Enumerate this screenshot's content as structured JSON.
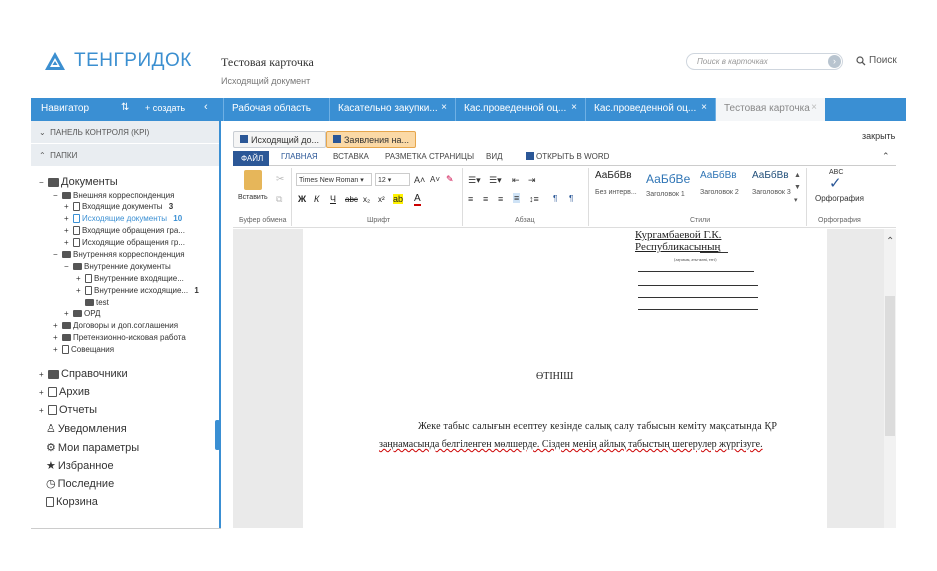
{
  "header": {
    "logo_text": "ТЕНГРИДОК",
    "card_title": "Тестовая карточка",
    "card_subtitle": "Исходящий документ",
    "search_placeholder": "Поиск в карточках",
    "search_label": "Поиск"
  },
  "navigator": {
    "title": "Навигатор",
    "sort_glyph": "⇅",
    "create_label": "+  создать",
    "collapse_glyph": "‹"
  },
  "tabs": [
    {
      "label": "Рабочая область",
      "closable": false
    },
    {
      "label": "Касательно закупки...",
      "closable": true
    },
    {
      "label": "Кас.проведенной оц...",
      "closable": true
    },
    {
      "label": "Кас.проведенной оц...",
      "closable": true
    },
    {
      "label": "Тестовая карточка",
      "closable": true
    }
  ],
  "sidebar": {
    "kpi_label": "ПАНЕЛЬ КОНТРОЛЯ (KPI)",
    "folders_label": "ПАПКИ",
    "tree": {
      "documents": "Документы",
      "external": "Внешняя корреспонденция",
      "incoming_docs": "Входящие документы",
      "incoming_docs_count": "3",
      "outgoing_docs": "Исходящие документы",
      "outgoing_docs_count": "10",
      "incoming_appeals": "Входящие обращения гра...",
      "outgoing_appeals": "Исходящие обращения гр...",
      "internal": "Внутренняя корреспонденция",
      "internal_docs": "Внутренние документы",
      "internal_incoming": "Внутренние входящие...",
      "internal_outgoing": "Внутренние исходящие...",
      "internal_outgoing_count": "1",
      "test": "test",
      "ord": "ОРД",
      "contracts": "Договоры и доп.соглашения",
      "claims": "Претензионно-исковая работа",
      "meetings": "Совещания"
    },
    "sections": [
      "Справочники",
      "Архив",
      "Отчеты",
      "Уведомления",
      "Мои параметры",
      "Избранное",
      "Последние",
      "Корзина"
    ]
  },
  "content": {
    "close_label": "закрыть",
    "file_tabs": [
      "Исходящий до...",
      "Заявления на..."
    ],
    "ribbon_tabs": [
      "ФАЙЛ",
      "ГЛАВНАЯ",
      "ВСТАВКА",
      "РАЗМЕТКА СТРАНИЦЫ",
      "ВИД",
      "ОТКРЫТЬ В WORD"
    ],
    "ribbon": {
      "paste": "Вставить",
      "font_name": "Times New Roman",
      "font_size": "12",
      "groups": [
        "Буфер обмена",
        "Шрифт",
        "Абзац",
        "Стили",
        "Орфография"
      ],
      "styles": [
        {
          "preview": "АаБбВв",
          "label": "Без интерв..."
        },
        {
          "preview": "АаБбВе",
          "label": "Заголовок 1"
        },
        {
          "preview": "АаБбВв",
          "label": "Заголовок 2"
        },
        {
          "preview": "АаБбВв",
          "label": "Заголовок 3"
        }
      ],
      "spelling": "Орфография",
      "spelling_abc": "ABC"
    },
    "document": {
      "line1": "Кургамбаевой Г.К.",
      "line2": "Республикасының",
      "small": "(лауазым, аты-жөні, тегі)",
      "heading": "ӨТІНІШ",
      "para1": "Жеке табыс салығын есептеу кезінде салық салу табысын кеміту  мақсатында  ҚР",
      "para2": "заңнамасында белгіленген мөлшерде. Сізден менің айлық табыстың шегерулер жүргізуге."
    }
  },
  "colors": {
    "accent": "#3a8fd3",
    "file_tab": "#2b5797",
    "active_pill": "#fbd9a6"
  }
}
